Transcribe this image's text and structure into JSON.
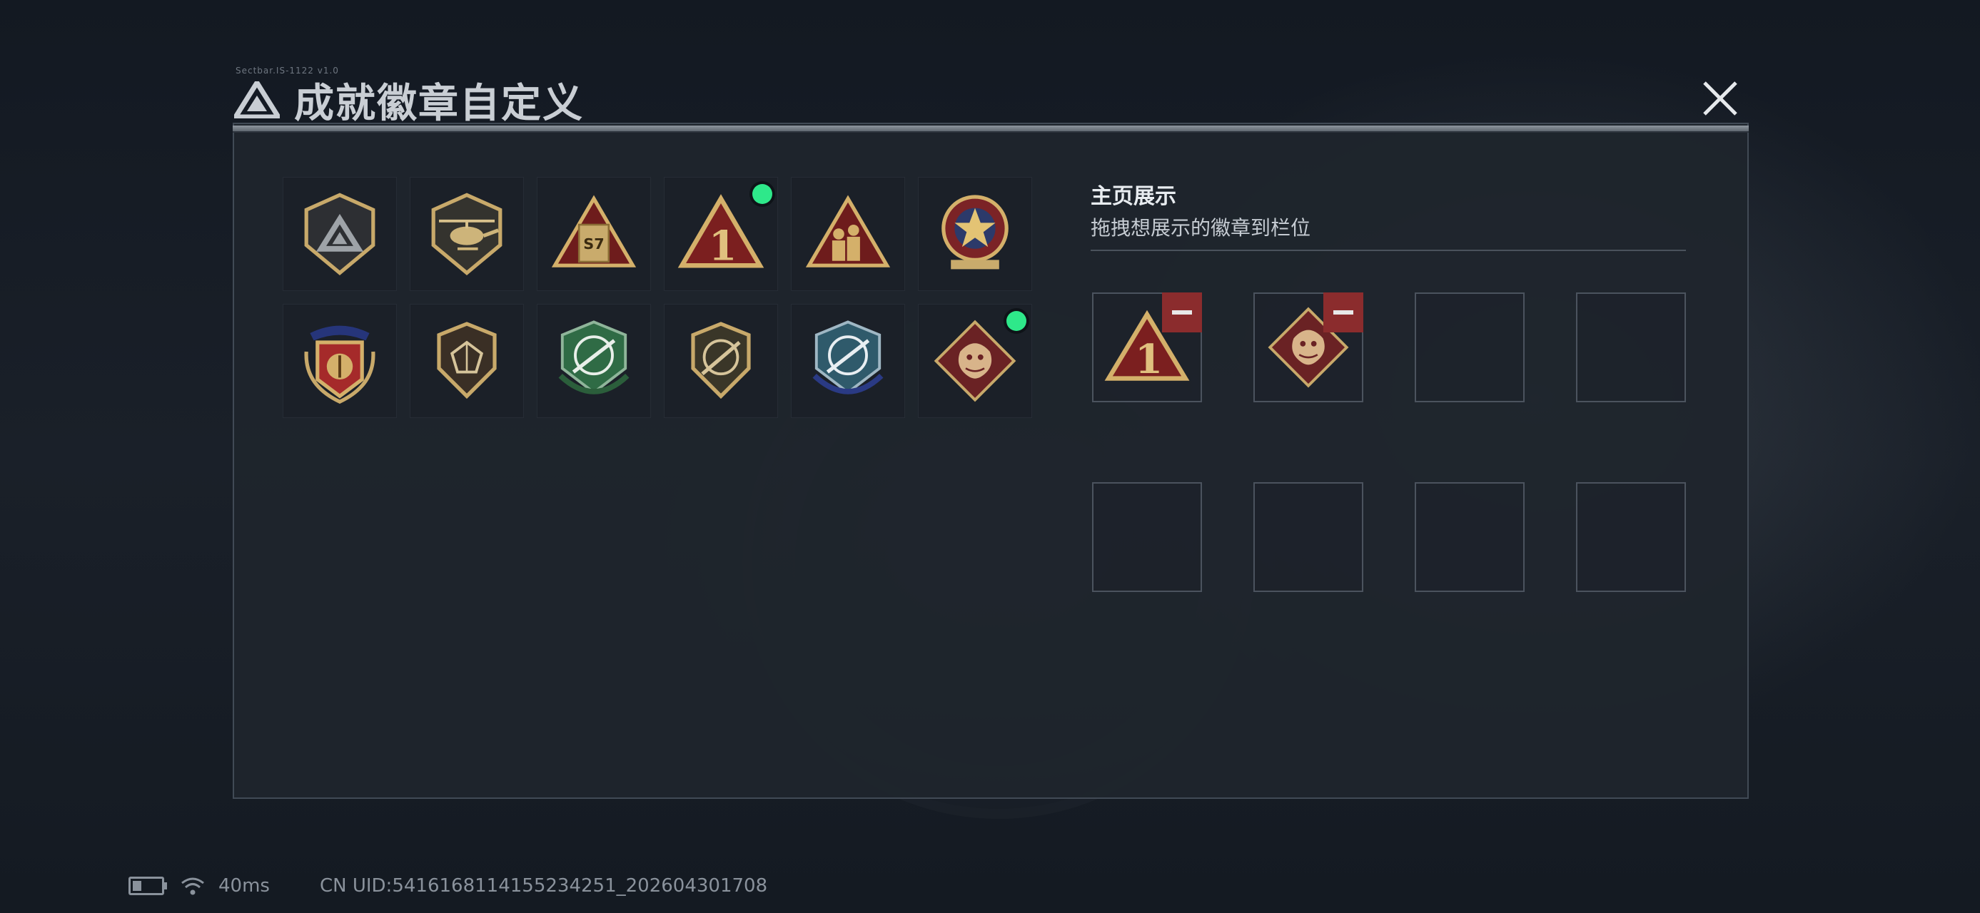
{
  "header": {
    "title": "成就徽章自定义",
    "meta": "Sectbar.IS-1122 v1.0"
  },
  "colors": {
    "accent_new": "#2ee88a",
    "remove": "#8b2c2d",
    "panel": "#1f252d",
    "gold": "#c8a96a",
    "crimson": "#7b1f1f"
  },
  "badges": [
    {
      "icon": "shield-triangle-logo-badge-icon",
      "new": false
    },
    {
      "icon": "helicopter-badge-icon",
      "new": false
    },
    {
      "icon": "s7-triangle-badge-icon",
      "new": false,
      "text": "S7"
    },
    {
      "icon": "number-one-triangle-badge-icon",
      "new": true,
      "text": "1"
    },
    {
      "icon": "soldiers-triangle-badge-icon",
      "new": false
    },
    {
      "icon": "star-crest-badge-icon",
      "new": false
    },
    {
      "icon": "laurel-crest-badge-icon",
      "new": false
    },
    {
      "icon": "geometric-shield-badge-icon",
      "new": false
    },
    {
      "icon": "green-crosshair-rifle-badge-icon",
      "new": false
    },
    {
      "icon": "crossed-rifle-badge-icon",
      "new": false
    },
    {
      "icon": "blue-crosshair-sniper-badge-icon",
      "new": false
    },
    {
      "icon": "dragon-diamond-badge-icon",
      "new": true
    }
  ],
  "display": {
    "title": "主页展示",
    "subtitle": "拖拽想展示的徽章到栏位",
    "slots": [
      {
        "badge": "number-one-triangle-badge-icon",
        "text": "1"
      },
      {
        "badge": "dragon-diamond-badge-icon"
      },
      {
        "badge": null
      },
      {
        "badge": null
      },
      {
        "badge": null
      },
      {
        "badge": null
      },
      {
        "badge": null
      },
      {
        "badge": null
      }
    ]
  },
  "status": {
    "ping": "40ms",
    "uid": "CN UID:5416168114155234251_202604301708"
  }
}
